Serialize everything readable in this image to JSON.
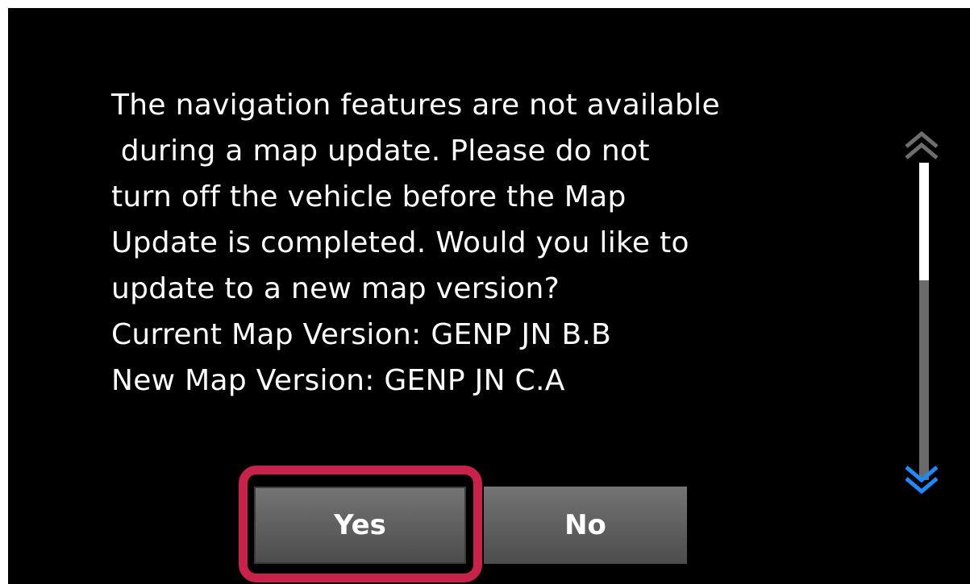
{
  "dialog": {
    "message_lines": [
      "The navigation features are not available",
      " during a map update. Please do not",
      "turn off the vehicle before the Map",
      "Update is completed. Would you like to",
      "update to a new map version?",
      "Current Map Version: GENP JN B.B",
      "New Map Version: GENP JN C.A"
    ],
    "yes_label": "Yes",
    "no_label": "No"
  },
  "scrollbar": {
    "up_icon": "double-chevron-up-icon",
    "down_icon": "double-chevron-down-icon",
    "up_color": "#6e6e6e",
    "down_color": "#1a8cff",
    "thumb_position": 0.0
  },
  "colors": {
    "background": "#000000",
    "text": "#ffffff",
    "highlight": "#c8224a"
  }
}
